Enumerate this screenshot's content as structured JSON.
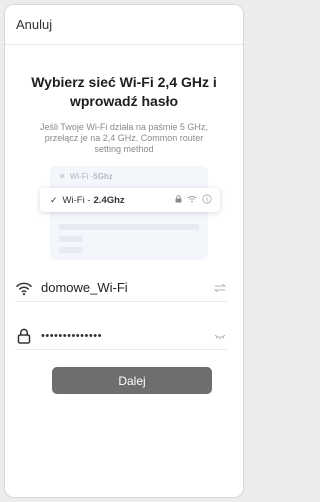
{
  "header": {
    "cancel_label": "Anuluj"
  },
  "main": {
    "title": "Wybierz sieć Wi-Fi 2,4 GHz i wprowadź hasło",
    "description": "Jeśli Twoje Wi-Fi działa na paśmie 5 GHz, przełącz je na 2,4 GHz. Common router setting method"
  },
  "illustration": {
    "row_5g_prefix": "Wi-Fi - ",
    "row_5g_band": "5Ghz",
    "row_24_prefix": "Wi-Fi - ",
    "row_24_band": "2.4Ghz"
  },
  "form": {
    "wifi_name": "domowe_Wi-Fi",
    "password_masked": "••••••••••••••"
  },
  "actions": {
    "next_label": "Dalej"
  },
  "colors": {
    "button_bg": "#6e6e6e",
    "illustration_bg": "#f3f6fb"
  }
}
